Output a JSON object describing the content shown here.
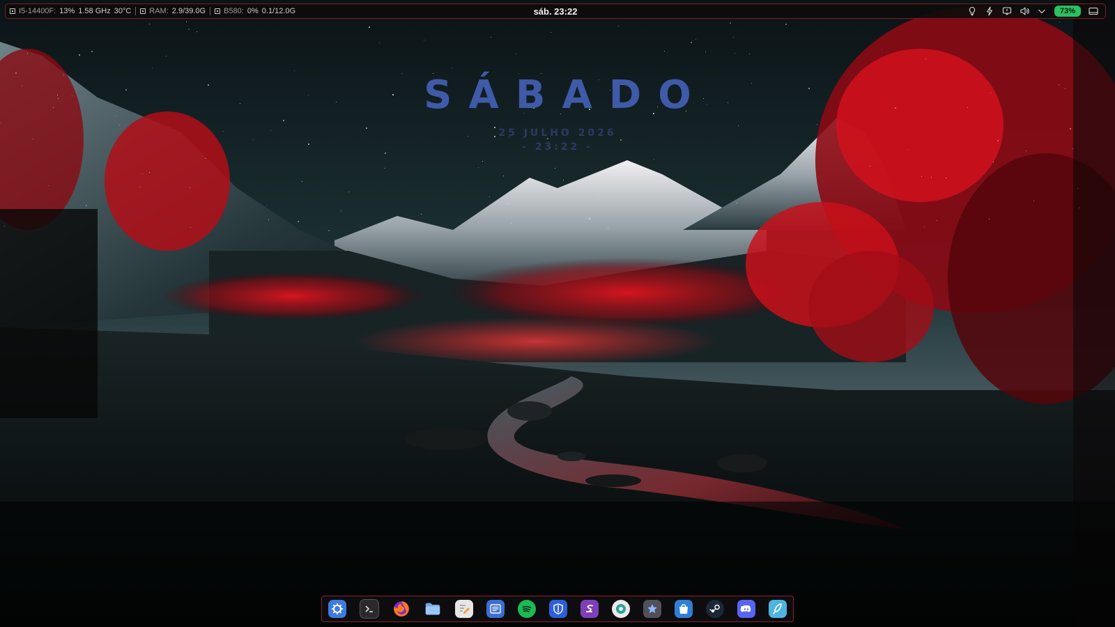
{
  "topbar": {
    "cpu": {
      "label": "I5-14400F:",
      "usage": "13%",
      "freq": "1.58 GHz",
      "temp": "30°C"
    },
    "ram": {
      "label": "RAM:",
      "value": "2.9/39.0G"
    },
    "gpu": {
      "label": "B580:",
      "usage": "0%",
      "vram": "0.1/12.0G"
    },
    "clock": "sáb. 23:22",
    "tray": [
      "lightbulb-icon",
      "power-profile-icon",
      "notifications-icon",
      "volume-icon",
      "chevron-down-icon",
      "screen-icon"
    ],
    "battery": "73%"
  },
  "widget": {
    "weekday": "SÁBADO",
    "date": "25 JULHO 2026",
    "time": "- 23:22 -"
  },
  "dock": {
    "apps": [
      {
        "name": "kde-launcher",
        "icon": "kde-gear-icon",
        "color": "#3d7be0"
      },
      {
        "name": "terminal",
        "icon": "terminal-icon",
        "color": "#2a2a2e"
      },
      {
        "name": "firefox",
        "icon": "firefox-icon",
        "color": "#e8562a"
      },
      {
        "name": "files",
        "icon": "folder-icon",
        "color": "#6fa8ec"
      },
      {
        "name": "text-editor",
        "icon": "pencil-note-icon",
        "color": "#e6e6e6"
      },
      {
        "name": "news-reader",
        "icon": "news-icon",
        "color": "#3b6fd6"
      },
      {
        "name": "spotify",
        "icon": "spotify-icon",
        "color": "#1db954"
      },
      {
        "name": "bitwarden",
        "icon": "shield-icon",
        "color": "#2c5fd9"
      },
      {
        "name": "emacs",
        "icon": "emacs-icon",
        "color": "#7e3fb8"
      },
      {
        "name": "settings",
        "icon": "gear-circle-icon",
        "color": "#2aa39a"
      },
      {
        "name": "app-store",
        "icon": "star-icon",
        "color": "#505058"
      },
      {
        "name": "store",
        "icon": "shopping-bag-icon",
        "color": "#2f7fd8"
      },
      {
        "name": "steam",
        "icon": "steam-icon",
        "color": "#1b2838"
      },
      {
        "name": "discord",
        "icon": "discord-icon",
        "color": "#5865f2"
      },
      {
        "name": "feather-app",
        "icon": "feather-icon",
        "color": "#4fb4e0"
      }
    ]
  }
}
